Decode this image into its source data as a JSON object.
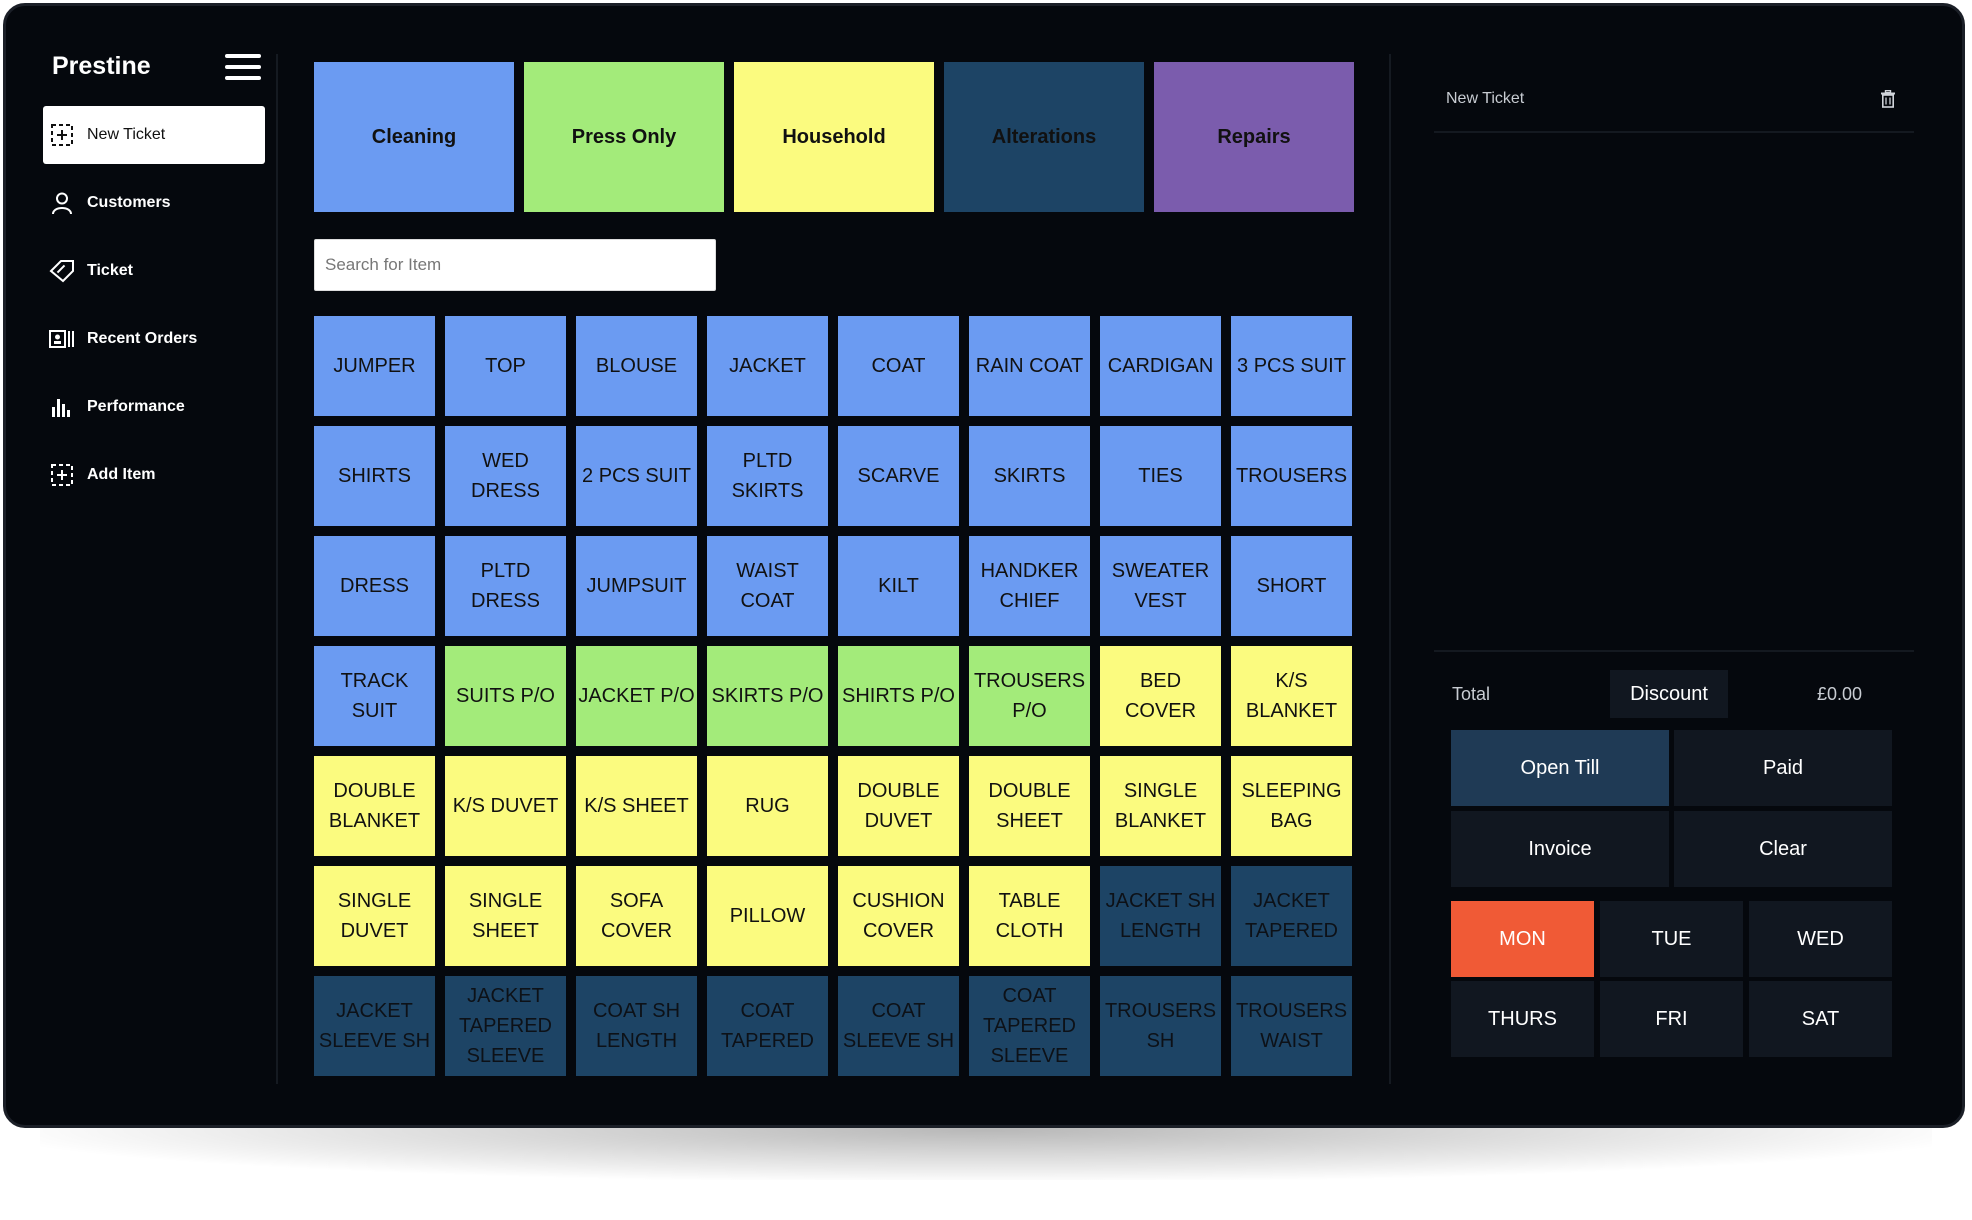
{
  "app": {
    "brand": "Prestine"
  },
  "sidebar": {
    "items": [
      {
        "label": "New Ticket",
        "icon": "add-square-icon",
        "active": true
      },
      {
        "label": "Customers",
        "icon": "user-icon"
      },
      {
        "label": "Ticket",
        "icon": "ticket-tag-icon"
      },
      {
        "label": "Recent Orders",
        "icon": "recent-orders-icon"
      },
      {
        "label": "Performance",
        "icon": "bar-chart-icon"
      },
      {
        "label": "Add Item",
        "icon": "add-item-icon"
      }
    ]
  },
  "categories": [
    {
      "label": "Cleaning",
      "color": "#6b9bf2"
    },
    {
      "label": "Press Only",
      "color": "#a3eb7a"
    },
    {
      "label": "Household",
      "color": "#fbfb7f"
    },
    {
      "label": "Alterations",
      "color": "#1d4465"
    },
    {
      "label": "Repairs",
      "color": "#7b5cad"
    }
  ],
  "search": {
    "placeholder": "Search for Item",
    "value": ""
  },
  "colors": {
    "cleaning": "#6b9bf2",
    "press_only": "#a3eb7a",
    "household": "#fbfb7f",
    "alterations": "#1d4465",
    "accent_day": "#f05a36",
    "button_dark": "#111720",
    "open_till": "#1f3a55"
  },
  "items": [
    {
      "label": "JUMPER",
      "group": "cleaning"
    },
    {
      "label": "TOP",
      "group": "cleaning"
    },
    {
      "label": "BLOUSE",
      "group": "cleaning"
    },
    {
      "label": "JACKET",
      "group": "cleaning"
    },
    {
      "label": "COAT",
      "group": "cleaning"
    },
    {
      "label": "RAIN COAT",
      "group": "cleaning"
    },
    {
      "label": "CARDIGAN",
      "group": "cleaning"
    },
    {
      "label": "3 PCS SUIT",
      "group": "cleaning"
    },
    {
      "label": "SHIRTS",
      "group": "cleaning"
    },
    {
      "label": "WED DRESS",
      "group": "cleaning"
    },
    {
      "label": "2 PCS SUIT",
      "group": "cleaning"
    },
    {
      "label": "PLTD SKIRTS",
      "group": "cleaning"
    },
    {
      "label": "SCARVE",
      "group": "cleaning"
    },
    {
      "label": "SKIRTS",
      "group": "cleaning"
    },
    {
      "label": "TIES",
      "group": "cleaning"
    },
    {
      "label": "TROUSERS",
      "group": "cleaning"
    },
    {
      "label": "DRESS",
      "group": "cleaning"
    },
    {
      "label": "PLTD DRESS",
      "group": "cleaning"
    },
    {
      "label": "JUMPSUIT",
      "group": "cleaning"
    },
    {
      "label": "WAIST COAT",
      "group": "cleaning"
    },
    {
      "label": "KILT",
      "group": "cleaning"
    },
    {
      "label": "HANDKER CHIEF",
      "group": "cleaning"
    },
    {
      "label": "SWEATER VEST",
      "group": "cleaning"
    },
    {
      "label": "SHORT",
      "group": "cleaning"
    },
    {
      "label": "TRACK SUIT",
      "group": "cleaning"
    },
    {
      "label": "SUITS P/O",
      "group": "press_only"
    },
    {
      "label": "JACKET P/O",
      "group": "press_only"
    },
    {
      "label": "SKIRTS P/O",
      "group": "press_only"
    },
    {
      "label": "SHIRTS P/O",
      "group": "press_only"
    },
    {
      "label": "TROUSERS P/O",
      "group": "press_only"
    },
    {
      "label": "BED COVER",
      "group": "household"
    },
    {
      "label": "K/S BLANKET",
      "group": "household"
    },
    {
      "label": "DOUBLE BLANKET",
      "group": "household"
    },
    {
      "label": "K/S DUVET",
      "group": "household"
    },
    {
      "label": "K/S SHEET",
      "group": "household"
    },
    {
      "label": "RUG",
      "group": "household"
    },
    {
      "label": "DOUBLE DUVET",
      "group": "household"
    },
    {
      "label": "DOUBLE SHEET",
      "group": "household"
    },
    {
      "label": "SINGLE BLANKET",
      "group": "household"
    },
    {
      "label": "SLEEPING BAG",
      "group": "household"
    },
    {
      "label": "SINGLE DUVET",
      "group": "household"
    },
    {
      "label": "SINGLE SHEET",
      "group": "household"
    },
    {
      "label": "SOFA COVER",
      "group": "household"
    },
    {
      "label": "PILLOW",
      "group": "household"
    },
    {
      "label": "CUSHION COVER",
      "group": "household"
    },
    {
      "label": "TABLE CLOTH",
      "group": "household"
    },
    {
      "label": "JACKET SH LENGTH",
      "group": "alterations"
    },
    {
      "label": "JACKET TAPERED",
      "group": "alterations"
    },
    {
      "label": "JACKET SLEEVE SH",
      "group": "alterations"
    },
    {
      "label": "JACKET TAPERED SLEEVE",
      "group": "alterations"
    },
    {
      "label": "COAT SH LENGTH",
      "group": "alterations"
    },
    {
      "label": "COAT TAPERED",
      "group": "alterations"
    },
    {
      "label": "COAT SLEEVE SH",
      "group": "alterations"
    },
    {
      "label": "COAT TAPERED SLEEVE",
      "group": "alterations"
    },
    {
      "label": "TROUSERS SH",
      "group": "alterations"
    },
    {
      "label": "TROUSERS WAIST",
      "group": "alterations"
    }
  ],
  "ticket": {
    "title": "New Ticket",
    "total_label": "Total",
    "discount_label": "Discount",
    "total_value": "£0.00",
    "actions": [
      "Open Till",
      "Paid",
      "Invoice",
      "Clear"
    ],
    "days": [
      "MON",
      "TUE",
      "WED",
      "THURS",
      "FRI",
      "SAT"
    ],
    "selected_day": "MON"
  }
}
